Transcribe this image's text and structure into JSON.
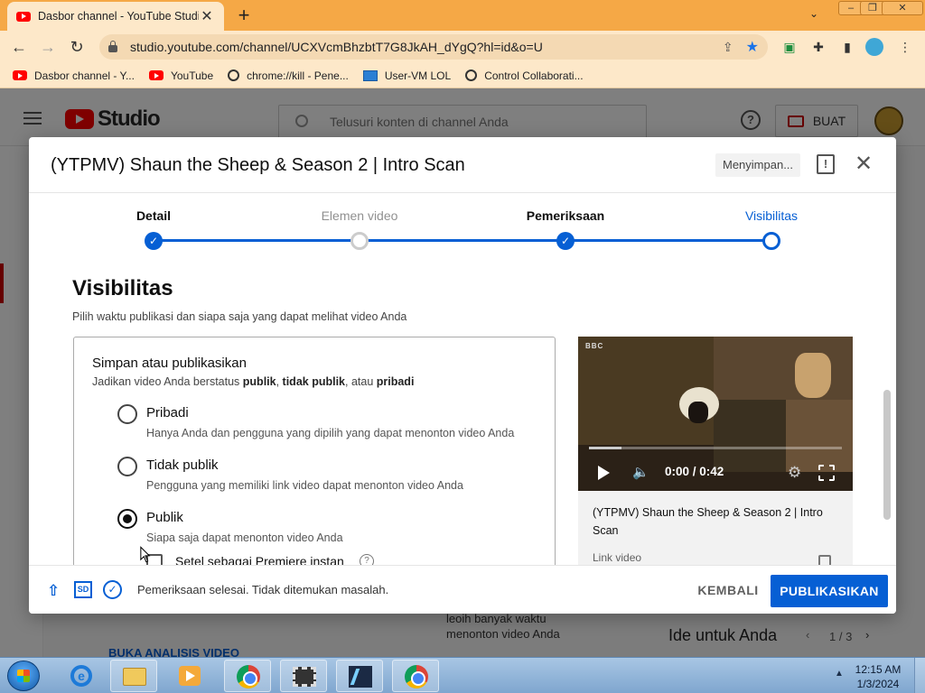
{
  "browser": {
    "tab_title": "Dasbor channel - YouTube Studio",
    "tab_close": "✕",
    "new_tab": "+",
    "url": "studio.youtube.com/channel/UCXVcmBhzbtT7G8JkAH_dYgQ?hl=id&o=U",
    "bookmarks": [
      {
        "label": "Dasbor channel - Y...",
        "icon": "youtube-icon"
      },
      {
        "label": "YouTube",
        "icon": "youtube-icon"
      },
      {
        "label": "chrome://kill - Pene...",
        "icon": "globe-icon"
      },
      {
        "label": "User-VM LOL",
        "icon": "monitor-icon"
      },
      {
        "label": "Control Collaborati...",
        "icon": "globe-icon"
      }
    ]
  },
  "studio": {
    "logo_text": "Studio",
    "search_placeholder": "Telusuri konten di channel Anda",
    "create_label": "BUAT",
    "bg_link": "BUKA ANALISIS VIDEO",
    "bg_text_1": "leoih banyak waktu",
    "bg_text_2": "menonton video Anda",
    "bg_ideas": "Ide untuk Anda",
    "bg_pager": "1 / 3"
  },
  "dialog": {
    "title": "(YTPMV) Shaun the Sheep & Season 2 | Intro Scan",
    "saving_label": "Menyimpan...",
    "steps": [
      {
        "label": "Detail",
        "state": "done"
      },
      {
        "label": "Elemen video",
        "state": "skipped"
      },
      {
        "label": "Pemeriksaan",
        "state": "done"
      },
      {
        "label": "Visibilitas",
        "state": "active"
      }
    ],
    "section_title": "Visibilitas",
    "section_subtitle": "Pilih waktu publikasi dan siapa saja yang dapat melihat video Anda",
    "publish_box": {
      "title": "Simpan atau publikasikan",
      "desc_prefix": "Jadikan video Anda berstatus ",
      "desc_b1": "publik",
      "desc_sep": ", ",
      "desc_b2": "tidak publik",
      "desc_mid": ", atau ",
      "desc_b3": "pribadi",
      "options": [
        {
          "label": "Pribadi",
          "desc": "Hanya Anda dan pengguna yang dipilih yang dapat menonton video Anda",
          "selected": false
        },
        {
          "label": "Tidak publik",
          "desc": "Pengguna yang memiliki link video dapat menonton video Anda",
          "selected": false
        },
        {
          "label": "Publik",
          "desc": "Siapa saja dapat menonton video Anda",
          "selected": true
        }
      ],
      "premiere_label": "Setel sebagai Premiere instan"
    },
    "video": {
      "channel_mark": "BBC",
      "time": "0:00 / 0:42",
      "progress": 0.13,
      "title": "(YTPMV) Shaun the Sheep & Season 2 | Intro Scan",
      "link_label": "Link video"
    },
    "footer": {
      "status": "Pemeriksaan selesai. Tidak ditemukan masalah.",
      "sd_label": "SD",
      "back_label": "KEMBALI",
      "publish_label": "PUBLIKASIKAN"
    }
  },
  "taskbar": {
    "time": "12:15 AM",
    "date": "1/3/2024"
  },
  "colors": {
    "accent": "#065fd4",
    "tabbar": "#f5a846",
    "youtube_red": "#ff0000"
  }
}
